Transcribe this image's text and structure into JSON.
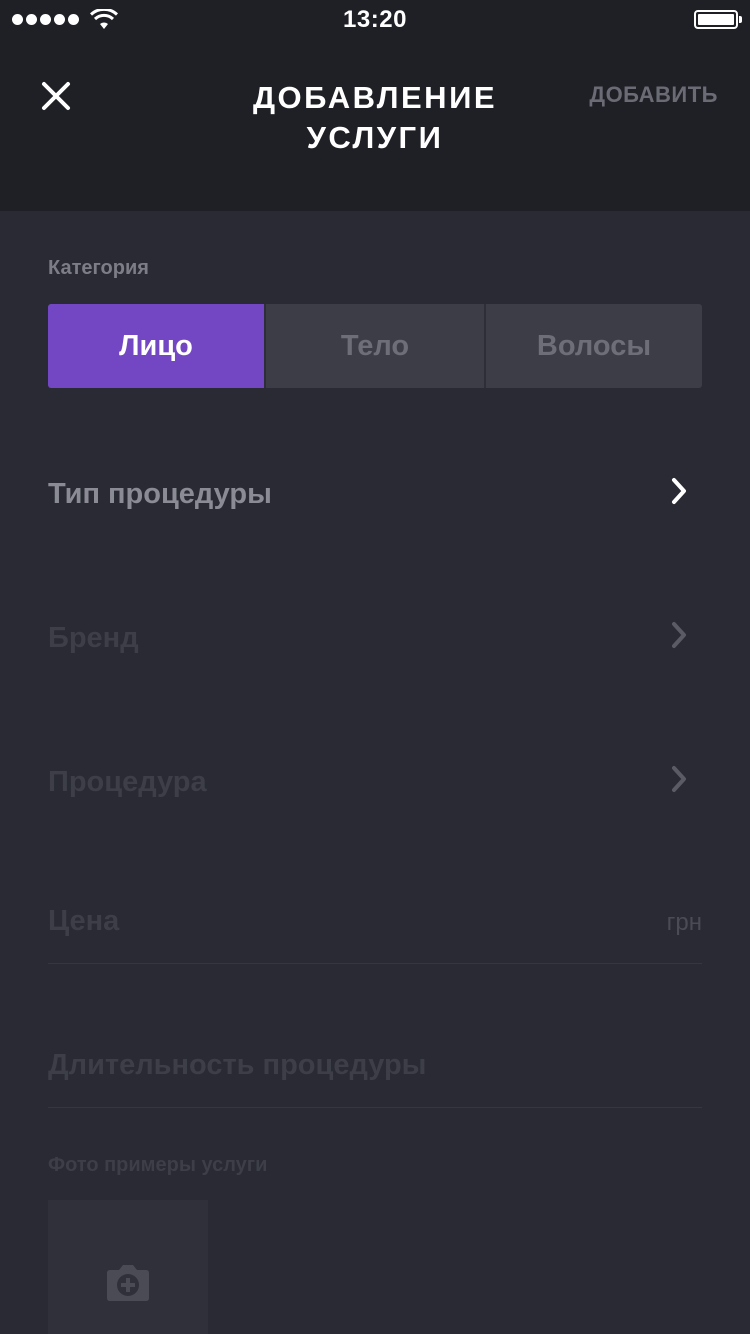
{
  "status_bar": {
    "time": "13:20"
  },
  "header": {
    "title_line1": "ДОБАВЛЕНИЕ",
    "title_line2": "УСЛУГИ",
    "add_label": "ДОБАВИТЬ"
  },
  "category": {
    "label": "Категория",
    "options": [
      "Лицо",
      "Тело",
      "Волосы"
    ],
    "selected": "Лицо"
  },
  "rows": {
    "procedure_type": "Тип процедуры",
    "brand": "Бренд",
    "procedure": "Процедура"
  },
  "fields": {
    "price_placeholder": "Цена",
    "price_unit": "грн",
    "duration_placeholder": "Длительность процедуры"
  },
  "photos": {
    "label": "Фото примеры услуги"
  },
  "colors": {
    "accent": "#7347c3",
    "background": "#292a33",
    "header": "#1f2026"
  }
}
